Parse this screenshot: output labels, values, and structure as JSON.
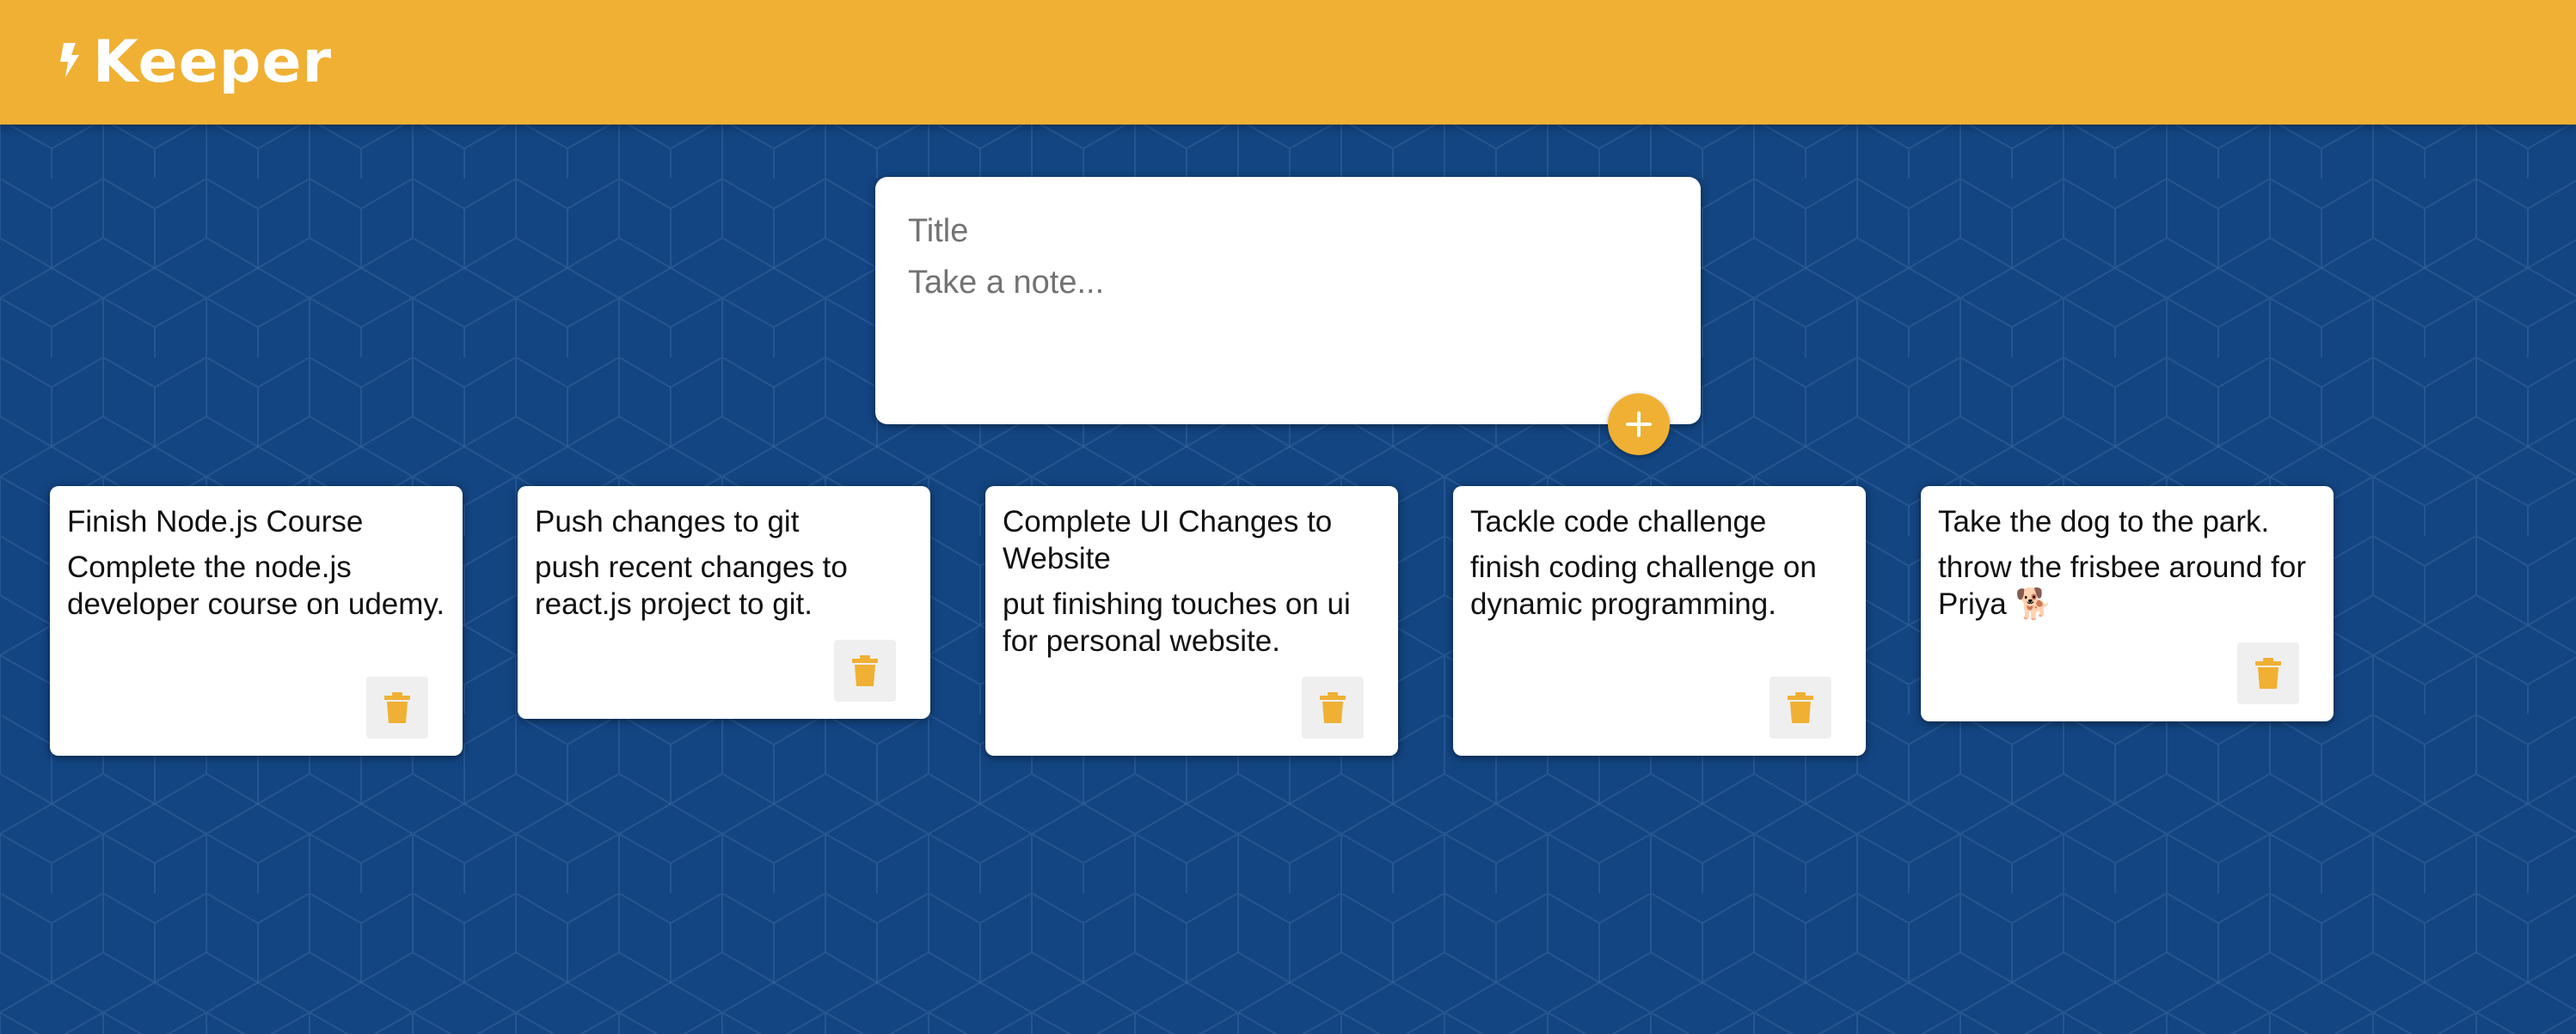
{
  "app": {
    "title": "Keeper",
    "logo_icon": "lightning-bolt-icon"
  },
  "colors": {
    "header": "#f0b033",
    "background": "#134582",
    "accent": "#f0b033"
  },
  "composer": {
    "title_placeholder": "Title",
    "content_placeholder": "Take a note...",
    "title_value": "",
    "content_value": "",
    "add_icon": "plus-icon"
  },
  "notes": [
    {
      "title": "Finish Node.js Course",
      "content": "Complete the node.js developer course on udemy.",
      "delete_icon": "trash-icon"
    },
    {
      "title": "Push changes to git",
      "content": "push recent changes to react.js project to git.",
      "delete_icon": "trash-icon"
    },
    {
      "title": "Complete UI Changes to Website",
      "content": "put finishing touches on ui for personal website.",
      "delete_icon": "trash-icon"
    },
    {
      "title": "Tackle code challenge",
      "content": "finish coding challenge on dynamic programming.",
      "delete_icon": "trash-icon"
    },
    {
      "title": "Take the dog to the park.",
      "content": "throw the frisbee around for Priya 🐕",
      "delete_icon": "trash-icon"
    }
  ]
}
